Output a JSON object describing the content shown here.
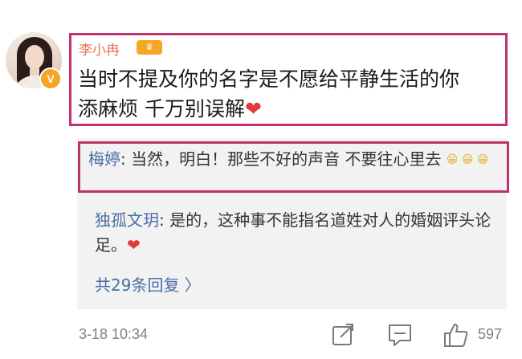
{
  "post": {
    "username": "李小冉",
    "text_line1": "当时不提及你的名字是不愿给平静生活的你",
    "text_line2": "添麻烦 千万别误解",
    "heart": "❤"
  },
  "replies": [
    {
      "name": "梅婷",
      "sep": ":",
      "text": " 当然，明白！那些不好的声音 不要往心里去 ",
      "emoji": "😁 😁 😁"
    },
    {
      "name": "独孤文玥",
      "sep": ":",
      "text": " 是的，这种事不能指名道姓对人的婚姻评头论足。",
      "emoji": "❤"
    }
  ],
  "more_replies": "共29条回复 〉",
  "footer": {
    "timestamp": "3-18 10:34",
    "like_count": "597"
  },
  "icons": {
    "verified": "verified-v-icon",
    "level": "user-level-icon",
    "share": "share-icon",
    "comment": "comment-icon",
    "like": "thumbs-up-icon"
  },
  "colors": {
    "highlight_border": "#c0326e",
    "username": "#eb7350",
    "reply_name": "#4a6fa5",
    "badge": "#f5a623"
  }
}
